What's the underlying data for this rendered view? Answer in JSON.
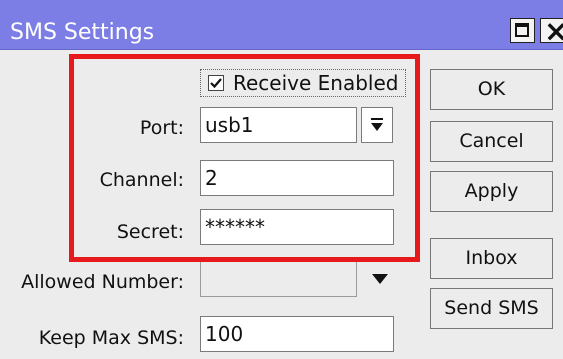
{
  "window": {
    "title": "SMS Settings"
  },
  "form": {
    "receive_enabled_label": "Receive Enabled",
    "receive_enabled_checked": true,
    "port_label": "Port:",
    "port_value": "usb1",
    "channel_label": "Channel:",
    "channel_value": "2",
    "secret_label": "Secret:",
    "secret_value": "******",
    "allowed_number_label": "Allowed Number:",
    "allowed_number_value": "",
    "keep_max_sms_label": "Keep Max SMS:",
    "keep_max_sms_value": "100"
  },
  "buttons": {
    "ok": "OK",
    "cancel": "Cancel",
    "apply": "Apply",
    "inbox": "Inbox",
    "send_sms": "Send SMS"
  },
  "colors": {
    "titlebar": "#7c7ee6",
    "highlight": "#e8191c",
    "background": "#ececec"
  },
  "icons": {
    "maximize": "maximize-icon",
    "close": "close-icon",
    "checkbox": "checkmark-icon",
    "dropdown": "dropdown-arrow-icon"
  }
}
